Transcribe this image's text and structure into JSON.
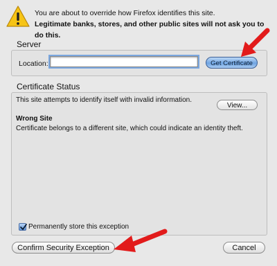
{
  "warning": {
    "line1": "You are about to override how Firefox identifies this site.",
    "line2": "Legitimate banks, stores, and other public sites will not ask you to do this."
  },
  "server": {
    "title": "Server",
    "location_label": "Location:",
    "location_value": "",
    "get_certificate_label": "Get Certificate"
  },
  "certificate_status": {
    "title": "Certificate Status",
    "message": "This site attempts to identify itself with invalid information.",
    "view_label": "View...",
    "wrong_site_heading": "Wrong Site",
    "wrong_site_description": "Certificate belongs to a different site, which could indicate an identity theft."
  },
  "permanent_store": {
    "label": "Permanently store this exception",
    "checked": true
  },
  "buttons": {
    "confirm_label": "Confirm Security Exception",
    "cancel_label": "Cancel"
  },
  "colors": {
    "accent_blue": "#6fa4e2",
    "annotation_red": "#e21b1b",
    "warning_yellow": "#f6c416"
  },
  "icons": {
    "warning": "warning-triangle-icon",
    "checkbox_check": "check-icon",
    "annotation_arrow": "red-arrow-annotation"
  }
}
